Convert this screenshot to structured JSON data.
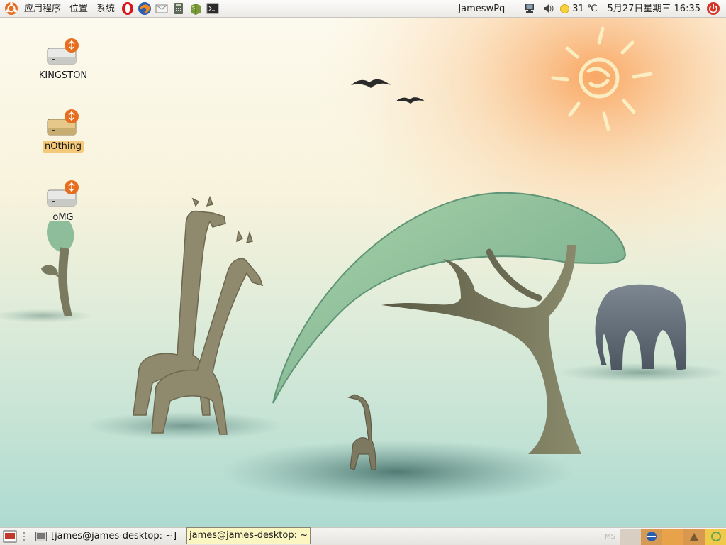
{
  "top_panel": {
    "menus": [
      "应用程序",
      "位置",
      "系统"
    ],
    "launchers": [
      "opera-icon",
      "firefox-icon",
      "mail-icon",
      "calculator-icon",
      "book-icon",
      "terminal-icon"
    ],
    "user": "JameswPq",
    "weather_temp": "31 ℃",
    "datetime": "5月27日星期三 16:35"
  },
  "desktop_icons": [
    {
      "label": "KINGSTON",
      "selected": false
    },
    {
      "label": "nOthing",
      "selected": true
    },
    {
      "label": "oMG",
      "selected": false
    }
  ],
  "bottom_panel": {
    "task_label": "[james@james-desktop: ~]",
    "tooltip": "james@james-desktop: ~",
    "workspace_text": "MS"
  },
  "colors": {
    "accent_orange": "#e66e1e",
    "selection": "#f5c97a",
    "tooltip_bg": "#fbf6c2"
  }
}
